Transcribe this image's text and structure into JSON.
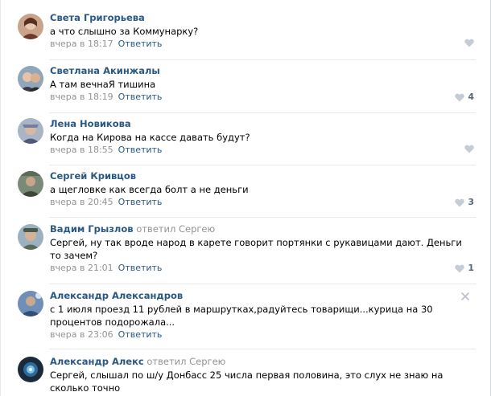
{
  "comments": [
    {
      "author": "Света Григорьева",
      "replied": "",
      "reply_to": "",
      "text": "а что слышно за Коммунарку?",
      "time": "вчера в 18:17",
      "reply_label": "Ответить",
      "likes": ""
    },
    {
      "author": "Светлана Акинжалы",
      "replied": "",
      "reply_to": "",
      "text": "А там вечнаЯ тишина",
      "time": "вчера в 18:19",
      "reply_label": "Ответить",
      "likes": "4"
    },
    {
      "author": "Лена Новикова",
      "replied": "",
      "reply_to": "",
      "text": "Когда на Кирова на кассе давать будут?",
      "time": "вчера в 18:55",
      "reply_label": "Ответить",
      "likes": ""
    },
    {
      "author": "Сергей Кривцов",
      "replied": "",
      "reply_to": "",
      "text": "а щегловке как всегда болт а не деньги",
      "time": "вчера в 20:45",
      "reply_label": "Ответить",
      "likes": "3"
    },
    {
      "author": "Вадим Грызлов",
      "replied": "ответил",
      "reply_to": "Сергею",
      "text": "Сергей, ну так вроде народ в карете говорит портянки с рукавицами дают. Деньги то зачем?",
      "time": "вчера в 21:01",
      "reply_label": "Ответить",
      "likes": "1"
    },
    {
      "author": "Александр Александров",
      "replied": "",
      "reply_to": "",
      "text": "с 1 июля проезд 11 рублей в маршрутках,радуйтесь товарищи...курица на 30 процентов подорожала...",
      "time": "вчера в 23:06",
      "reply_label": "Ответить",
      "likes": ""
    },
    {
      "author": "Александр Алекс",
      "replied": "ответил",
      "reply_to": "Сергею",
      "text": "Сергей, слышал по ш/у Донбасс 25 числа первая половина, это слух не знаю на сколько точно",
      "time": "",
      "reply_label": "",
      "likes": ""
    }
  ],
  "colors": {
    "author_link": "#2a5885",
    "secondary_text": "#939393",
    "divider": "#e7e8ec"
  },
  "icons": {
    "like": "heart-icon",
    "delete": "close-icon"
  }
}
